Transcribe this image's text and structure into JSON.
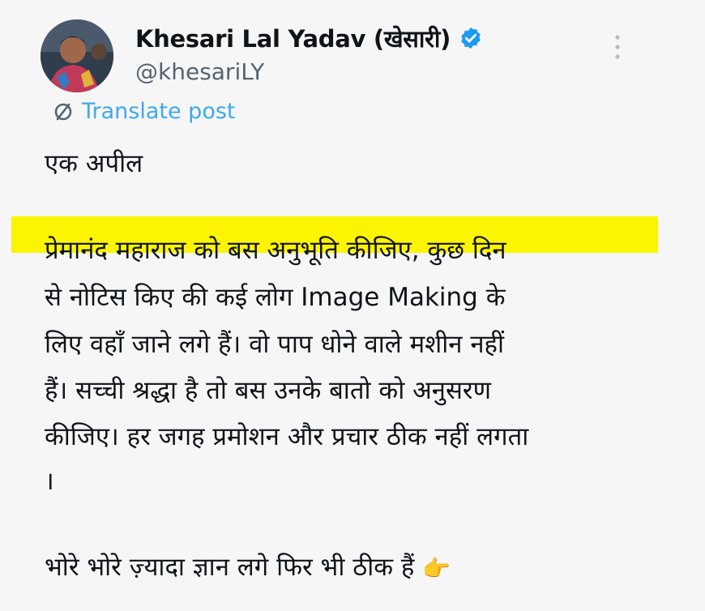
{
  "author": {
    "name": "Khesari Lal Yadav (खेसारी)",
    "handle": "@khesariLY"
  },
  "translate": {
    "label": "Translate post"
  },
  "post": {
    "title_line": "एक अपील",
    "lines": [
      "प्रेमानंद महाराज को बस अनुभूति कीजिए, कुछ दिन",
      "से नोटिस किए की कई लोग Image Making के",
      "लिए वहाँ जाने लगे हैं। वो पाप धोने वाले मशीन नहीं",
      "हैं। सच्ची श्रद्धा है तो बस उनके बातो को अनुसरण",
      "कीजिए। हर जगह प्रमोशन और प्रचार ठीक नहीं लगता",
      "।"
    ],
    "closing_line": "भोरे भोरे ज़्यादा ज्ञान लगे फिर भी ठीक हैं",
    "closing_emoji": "👉"
  },
  "colors": {
    "highlight": "#fdf400",
    "link": "#1d9bf0",
    "verified": "#1d9bf0"
  }
}
